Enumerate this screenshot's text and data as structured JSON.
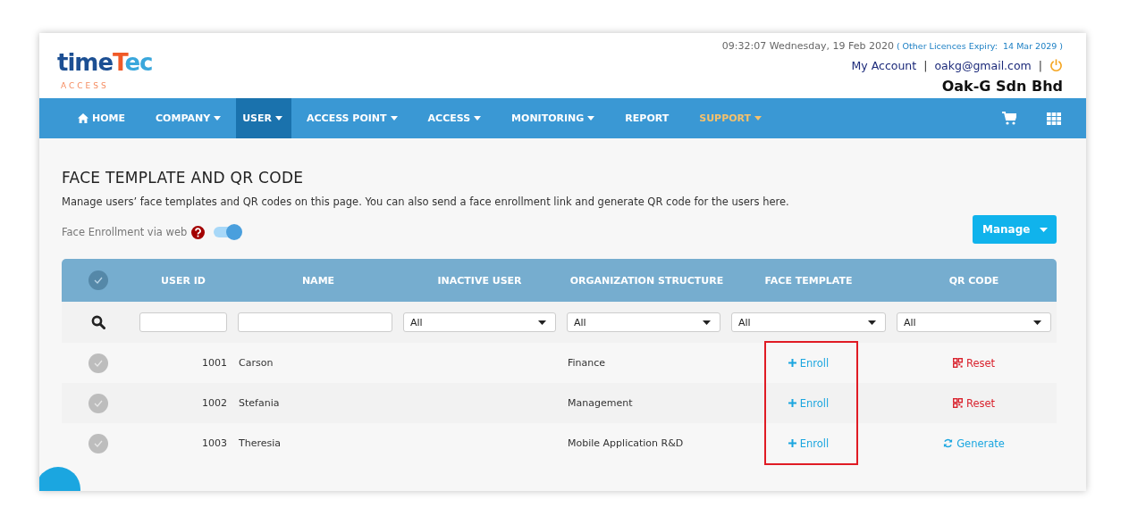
{
  "logo": {
    "word_start": "time",
    "word_key": "T",
    "word_end": "ec",
    "tagline": "ACCESS"
  },
  "header": {
    "datetime": "09:32:07 Wednesday, 19 Feb 2020",
    "licence_open": "(",
    "licence_label": "Other Licences Expiry:",
    "licence_date": "14 Mar 2029",
    "licence_close": ")",
    "my_account": "My Account",
    "separator_1": "|",
    "email": "oakg@gmail.com",
    "separator_2": "|",
    "company": "Oak-G Sdn Bhd"
  },
  "nav": [
    {
      "label": "HOME",
      "kind": "home",
      "dropdown": false,
      "selected": false,
      "highlighted": false
    },
    {
      "label": "COMPANY",
      "kind": "menu",
      "dropdown": true,
      "selected": false,
      "highlighted": false
    },
    {
      "label": "USER",
      "kind": "menu",
      "dropdown": true,
      "selected": true,
      "highlighted": false
    },
    {
      "label": "ACCESS POINT",
      "kind": "menu",
      "dropdown": true,
      "selected": false,
      "highlighted": false
    },
    {
      "label": "ACCESS",
      "kind": "menu",
      "dropdown": true,
      "selected": false,
      "highlighted": false
    },
    {
      "label": "MONITORING",
      "kind": "menu",
      "dropdown": true,
      "selected": false,
      "highlighted": false
    },
    {
      "label": "REPORT",
      "kind": "menu",
      "dropdown": false,
      "selected": false,
      "highlighted": false
    },
    {
      "label": "SUPPORT",
      "kind": "menu",
      "dropdown": true,
      "selected": false,
      "highlighted": true
    }
  ],
  "page": {
    "title": "FACE TEMPLATE AND QR CODE",
    "description": "Manage users’ face templates and QR codes on this page. You can also send a face enrollment link and generate QR code for the users here.",
    "toggle_label": "Face Enrollment via web",
    "toggle_on": true,
    "manage_button": "Manage"
  },
  "table": {
    "select_all_checked": false,
    "face_template_framed": true,
    "columns": [
      {
        "label": "USER ID"
      },
      {
        "label": "NAME"
      },
      {
        "label": "INACTIVE USER"
      },
      {
        "label": "ORGANIZATION STRUCTURE"
      },
      {
        "label": "FACE TEMPLATE"
      },
      {
        "label": "QR CODE"
      }
    ],
    "filters": [
      {
        "kind": "text"
      },
      {
        "kind": "text"
      },
      {
        "kind": "select",
        "value": "All"
      },
      {
        "kind": "select",
        "value": "All"
      },
      {
        "kind": "select",
        "value": "All"
      },
      {
        "kind": "select",
        "value": "All"
      }
    ],
    "rows": [
      {
        "checked": false,
        "user_id": "1001",
        "name": "Carson",
        "org": "Finance",
        "face": "Enroll",
        "qr": {
          "kind": "reset",
          "label": "Reset"
        }
      },
      {
        "checked": false,
        "user_id": "1002",
        "name": "Stefania",
        "org": "Management",
        "face": "Enroll",
        "qr": {
          "kind": "reset",
          "label": "Reset"
        }
      },
      {
        "checked": false,
        "user_id": "1003",
        "name": "Theresia",
        "org": "Mobile Application R&D",
        "face": "Enroll",
        "qr": {
          "kind": "generate",
          "label": "Generate"
        }
      }
    ]
  }
}
